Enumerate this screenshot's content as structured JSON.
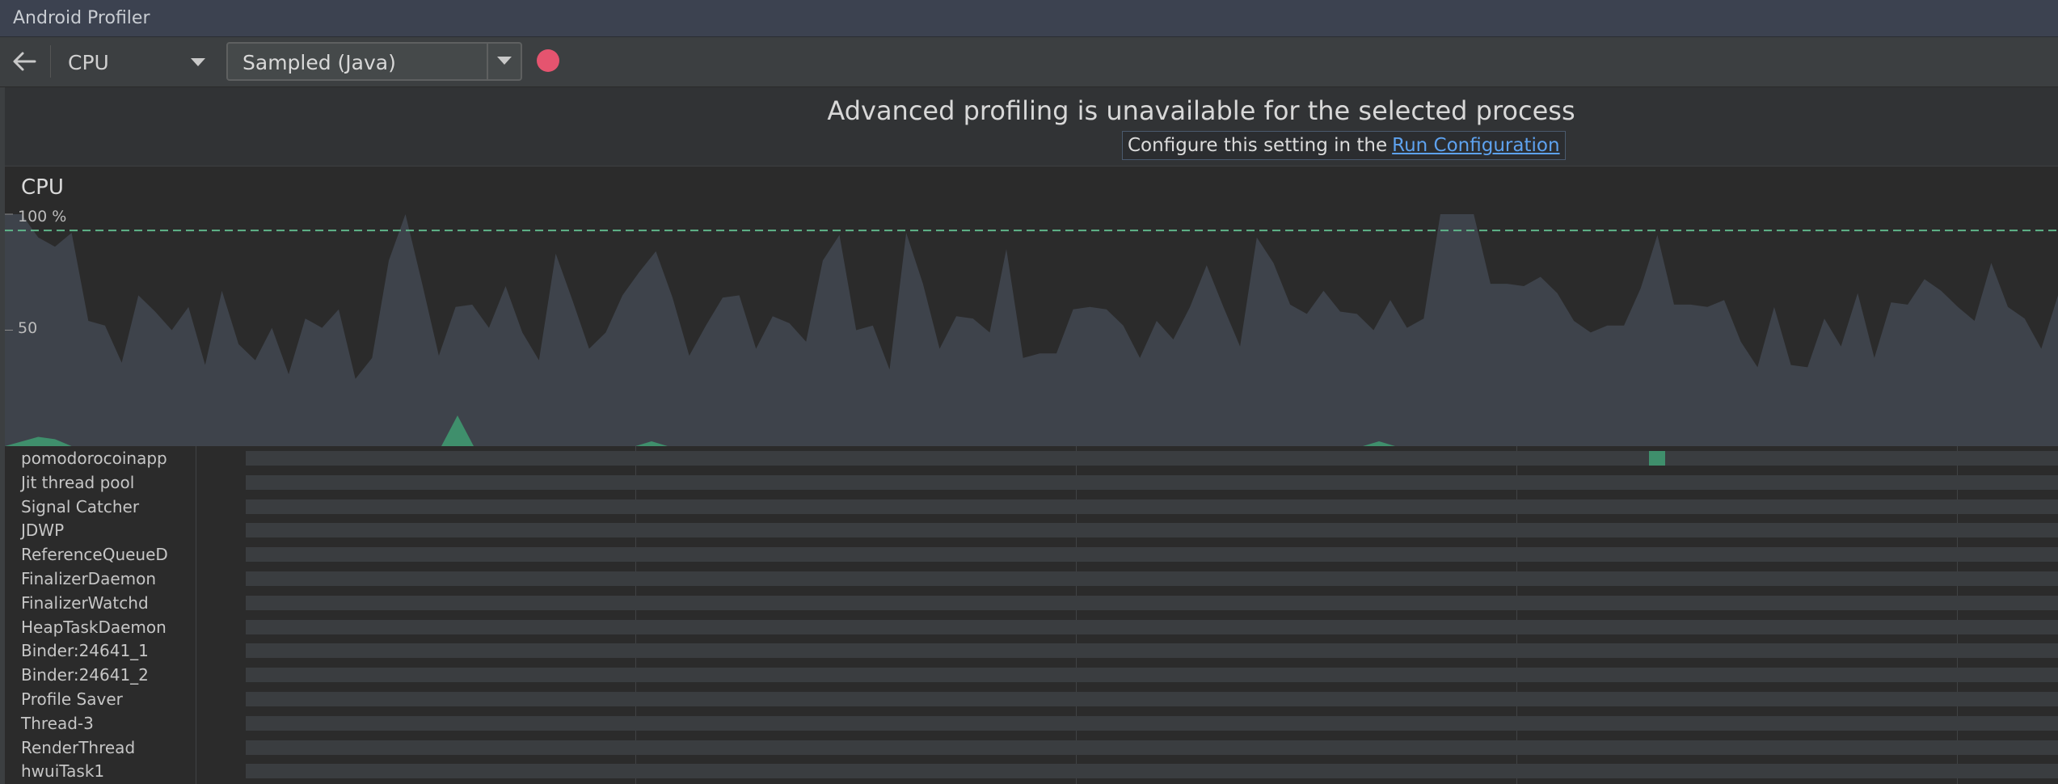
{
  "window": {
    "title": "Android Profiler"
  },
  "toolbar": {
    "back_icon": "arrow-left-icon",
    "profiler_label": "CPU",
    "mode_label": "Sampled (Java)",
    "record_color": "#e5546f"
  },
  "banner": {
    "headline": "Advanced profiling is unavailable for the selected process",
    "sub_text": "Configure this setting in the",
    "link_text": "Run Configuration"
  },
  "chart_data": {
    "type": "area",
    "title": "CPU",
    "y_ticks": [
      "100 %",
      "50"
    ],
    "ylim": [
      0,
      100
    ],
    "threshold": 93,
    "colors": {
      "app": "#3f8f6c",
      "total": "#3e434b",
      "threshold": "#5fb58a"
    },
    "series": [
      {
        "name": "",
        "values": [
          100,
          100,
          90,
          86,
          92,
          54,
          52,
          36,
          65,
          58,
          50,
          60,
          35,
          67,
          44,
          37,
          51,
          31,
          55,
          51,
          59,
          29,
          38,
          80,
          100,
          70,
          39,
          60,
          61,
          51,
          69,
          49,
          37,
          83,
          63,
          42,
          49,
          65,
          75,
          84,
          64,
          39,
          52,
          64,
          65,
          42,
          56,
          53,
          45,
          80,
          91,
          50,
          52,
          33,
          92,
          70,
          42,
          56,
          55,
          49,
          85,
          38,
          40,
          40,
          59,
          60,
          59,
          52,
          38,
          54,
          46,
          60,
          78,
          60,
          43,
          90,
          79,
          61,
          57,
          67,
          58,
          57,
          50,
          63,
          51,
          55,
          100,
          100,
          100,
          70,
          70,
          69,
          73,
          66,
          54,
          49,
          52,
          52,
          68,
          91,
          61,
          61,
          60,
          63,
          45,
          34,
          60,
          35,
          34,
          55,
          43,
          66,
          38,
          62,
          61,
          72,
          67,
          60,
          54,
          79,
          60,
          55,
          42,
          65
        ]
      },
      {
        "name": "",
        "values": [
          0,
          2,
          4,
          3,
          0,
          0,
          0,
          0,
          0,
          0,
          0,
          0,
          0,
          0,
          0,
          0,
          0,
          0,
          0,
          0,
          0,
          0,
          0,
          0,
          0,
          0,
          0,
          0,
          0,
          0,
          0,
          0,
          0,
          0,
          0,
          0,
          0,
          0,
          0,
          0,
          0,
          0,
          0,
          0,
          0,
          0,
          0,
          0,
          0,
          0,
          0,
          0,
          0,
          0,
          0,
          0,
          0,
          0,
          0,
          0,
          0,
          0,
          0,
          0,
          0,
          0,
          0,
          0,
          0,
          0,
          0,
          0,
          0,
          0,
          0,
          0,
          0,
          0,
          0,
          0,
          0,
          0,
          0,
          0,
          0,
          0,
          0,
          0,
          0,
          0,
          0,
          0,
          0,
          0,
          0,
          0,
          0,
          0,
          0,
          0,
          0,
          0,
          0,
          0,
          0,
          0,
          0,
          0,
          0,
          0,
          0,
          0,
          0,
          0,
          0,
          0,
          0,
          0,
          0,
          0,
          0,
          0,
          0,
          0
        ]
      }
    ]
  },
  "threads": {
    "items": [
      {
        "name": "pomodorocoinapp"
      },
      {
        "name": "Jit thread pool"
      },
      {
        "name": "Signal Catcher"
      },
      {
        "name": "JDWP"
      },
      {
        "name": "ReferenceQueueD"
      },
      {
        "name": "FinalizerDaemon"
      },
      {
        "name": "FinalizerWatchd"
      },
      {
        "name": "HeapTaskDaemon"
      },
      {
        "name": "Binder:24641_1"
      },
      {
        "name": "Binder:24641_2"
      },
      {
        "name": "Profile Saver"
      },
      {
        "name": "Thread-3"
      },
      {
        "name": "RenderThread"
      },
      {
        "name": "hwuiTask1"
      }
    ]
  }
}
